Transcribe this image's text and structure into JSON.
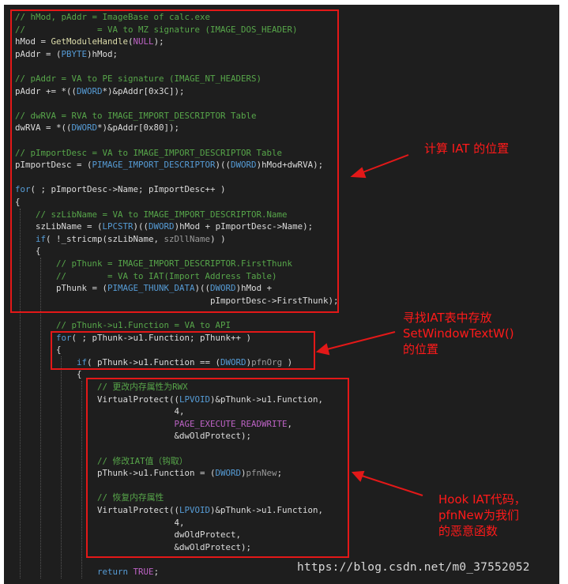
{
  "code_lines": [
    [
      {
        "c": "cm",
        "t": "// hMod, pAddr = ImageBase of calc.exe"
      }
    ],
    [
      {
        "c": "cm",
        "t": "//              = VA to MZ signature (IMAGE_DOS_HEADER)"
      }
    ],
    [
      {
        "c": "",
        "t": "hMod = "
      },
      {
        "c": "fn",
        "t": "GetModuleHandle"
      },
      {
        "c": "",
        "t": "("
      },
      {
        "c": "mc",
        "t": "NULL"
      },
      {
        "c": "",
        "t": ");"
      }
    ],
    [
      {
        "c": "",
        "t": "pAddr = ("
      },
      {
        "c": "ty",
        "t": "PBYTE"
      },
      {
        "c": "",
        "t": ")hMod;"
      }
    ],
    [],
    [
      {
        "c": "cm",
        "t": "// pAddr = VA to PE signature (IMAGE_NT_HEADERS)"
      }
    ],
    [
      {
        "c": "",
        "t": "pAddr += *(("
      },
      {
        "c": "ty",
        "t": "DWORD"
      },
      {
        "c": "",
        "t": "*)&pAddr[0x3C]);"
      }
    ],
    [],
    [
      {
        "c": "cm",
        "t": "// dwRVA = RVA to IMAGE_IMPORT_DESCRIPTOR Table"
      }
    ],
    [
      {
        "c": "",
        "t": "dwRVA = *(("
      },
      {
        "c": "ty",
        "t": "DWORD"
      },
      {
        "c": "",
        "t": "*)&pAddr[0x80]);"
      }
    ],
    [],
    [
      {
        "c": "cm",
        "t": "// pImportDesc = VA to IMAGE_IMPORT_DESCRIPTOR Table"
      }
    ],
    [
      {
        "c": "",
        "t": "pImportDesc = ("
      },
      {
        "c": "ty",
        "t": "PIMAGE_IMPORT_DESCRIPTOR"
      },
      {
        "c": "",
        "t": ")(("
      },
      {
        "c": "ty",
        "t": "DWORD"
      },
      {
        "c": "",
        "t": ")hMod+dwRVA);"
      }
    ],
    [],
    [
      {
        "c": "kw",
        "t": "for"
      },
      {
        "c": "",
        "t": "( ; pImportDesc->Name; pImportDesc++ )"
      }
    ],
    [
      {
        "c": "",
        "t": "{"
      }
    ],
    [
      {
        "c": "",
        "t": "    "
      },
      {
        "c": "cm",
        "t": "// szLibName = VA to IMAGE_IMPORT_DESCRIPTOR.Name"
      }
    ],
    [
      {
        "c": "",
        "t": "    szLibName = ("
      },
      {
        "c": "ty",
        "t": "LPCSTR"
      },
      {
        "c": "",
        "t": ")(("
      },
      {
        "c": "ty",
        "t": "DWORD"
      },
      {
        "c": "",
        "t": ")hMod + pImportDesc->Name);"
      }
    ],
    [
      {
        "c": "",
        "t": "    "
      },
      {
        "c": "kw",
        "t": "if"
      },
      {
        "c": "",
        "t": "( !_stricmp(szLibName, "
      },
      {
        "c": "pa",
        "t": "szDllName"
      },
      {
        "c": "",
        "t": ") )"
      }
    ],
    [
      {
        "c": "",
        "t": "    {"
      }
    ],
    [
      {
        "c": "",
        "t": "        "
      },
      {
        "c": "cm",
        "t": "// pThunk = IMAGE_IMPORT_DESCRIPTOR.FirstThunk"
      }
    ],
    [
      {
        "c": "",
        "t": "        "
      },
      {
        "c": "cm",
        "t": "//        = VA to IAT(Import Address Table)"
      }
    ],
    [
      {
        "c": "",
        "t": "        pThunk = ("
      },
      {
        "c": "ty",
        "t": "PIMAGE_THUNK_DATA"
      },
      {
        "c": "",
        "t": ")(("
      },
      {
        "c": "ty",
        "t": "DWORD"
      },
      {
        "c": "",
        "t": ")hMod +"
      }
    ],
    [
      {
        "c": "",
        "t": "                                      pImportDesc->FirstThunk);"
      }
    ],
    [],
    [
      {
        "c": "",
        "t": "        "
      },
      {
        "c": "cm",
        "t": "// pThunk->u1.Function = VA to API"
      }
    ],
    [
      {
        "c": "",
        "t": "        "
      },
      {
        "c": "kw",
        "t": "for"
      },
      {
        "c": "",
        "t": "( ; pThunk->u1.Function; pThunk++ )"
      }
    ],
    [
      {
        "c": "",
        "t": "        {"
      }
    ],
    [
      {
        "c": "",
        "t": "            "
      },
      {
        "c": "kw",
        "t": "if"
      },
      {
        "c": "",
        "t": "( pThunk->u1.Function == ("
      },
      {
        "c": "ty",
        "t": "DWORD"
      },
      {
        "c": "",
        "t": ")"
      },
      {
        "c": "pa",
        "t": "pfnOrg"
      },
      {
        "c": "",
        "t": " )"
      }
    ],
    [
      {
        "c": "",
        "t": "            {"
      }
    ],
    [
      {
        "c": "",
        "t": "                "
      },
      {
        "c": "cm",
        "t": "// 更改内存属性为RWX"
      }
    ],
    [
      {
        "c": "",
        "t": "                VirtualProtect(("
      },
      {
        "c": "ty",
        "t": "LPVOID"
      },
      {
        "c": "",
        "t": ")&pThunk->u1.Function,"
      }
    ],
    [
      {
        "c": "",
        "t": "                               4,"
      }
    ],
    [
      {
        "c": "",
        "t": "                               "
      },
      {
        "c": "mc",
        "t": "PAGE_EXECUTE_READWRITE"
      },
      {
        "c": "",
        "t": ","
      }
    ],
    [
      {
        "c": "",
        "t": "                               &dwOldProtect);"
      }
    ],
    [],
    [
      {
        "c": "",
        "t": "                "
      },
      {
        "c": "cm",
        "t": "// 修改IAT值（钩取）"
      }
    ],
    [
      {
        "c": "",
        "t": "                pThunk->u1.Function = ("
      },
      {
        "c": "ty",
        "t": "DWORD"
      },
      {
        "c": "",
        "t": ")"
      },
      {
        "c": "pa",
        "t": "pfnNew"
      },
      {
        "c": "",
        "t": ";"
      }
    ],
    [],
    [
      {
        "c": "",
        "t": "                "
      },
      {
        "c": "cm",
        "t": "// 恢复内存属性"
      }
    ],
    [
      {
        "c": "",
        "t": "                VirtualProtect(("
      },
      {
        "c": "ty",
        "t": "LPVOID"
      },
      {
        "c": "",
        "t": ")&pThunk->u1.Function,"
      }
    ],
    [
      {
        "c": "",
        "t": "                               4,"
      }
    ],
    [
      {
        "c": "",
        "t": "                               dwOldProtect,"
      }
    ],
    [
      {
        "c": "",
        "t": "                               &dwOldProtect);"
      }
    ],
    [],
    [
      {
        "c": "",
        "t": "                "
      },
      {
        "c": "kw",
        "t": "return"
      },
      {
        "c": "",
        "t": " "
      },
      {
        "c": "mc",
        "t": "TRUE"
      },
      {
        "c": "",
        "t": ";"
      }
    ]
  ],
  "annotations": {
    "calc_iat": "计算 IAT 的位置",
    "find_iat": [
      "寻找IAT表中存放",
      "SetWindowTextW()",
      "的位置"
    ],
    "hook_iat": [
      "Hook IAT代码，",
      "pfnNew为我们",
      "的恶意函数"
    ]
  },
  "watermark": "https://blog.csdn.net/m0_37552052",
  "colors": {
    "background": "#1e1e1e",
    "comment": "#57a64a",
    "keyword": "#569cd6",
    "macro": "#bd63c5",
    "annotation_red": "#e31818"
  }
}
